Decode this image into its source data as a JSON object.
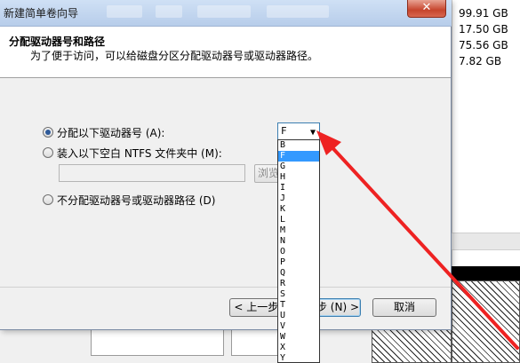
{
  "window": {
    "title": "新建简单卷向导",
    "close_glyph": "✕"
  },
  "header": {
    "title": "分配驱动器号和路径",
    "subtitle": "为了便于访问，可以给磁盘分区分配驱动器号或驱动器路径。"
  },
  "options": {
    "assign_letter": "分配以下驱动器号 (A):",
    "mount_folder": "装入以下空白 NTFS 文件夹中 (M):",
    "no_assign": "不分配驱动器号或驱动器路径 (D)",
    "browse_label": "浏览"
  },
  "drive_select": {
    "selected": "F",
    "arrow_glyph": "▼",
    "options": [
      "B",
      "F",
      "G",
      "H",
      "I",
      "J",
      "K",
      "L",
      "M",
      "N",
      "O",
      "P",
      "Q",
      "R",
      "S",
      "T",
      "U",
      "V",
      "W",
      "X",
      "Y"
    ]
  },
  "buttons": {
    "back": "< 上一步 (B)",
    "next": "下一步 (N) >",
    "cancel": "取消"
  },
  "background": {
    "disk_sizes": [
      "99.91 GB",
      "17.50 GB",
      "75.56 GB",
      "7.82 GB"
    ]
  },
  "colors": {
    "selection": "#3399ff",
    "annotation_arrow": "#ee2222"
  }
}
